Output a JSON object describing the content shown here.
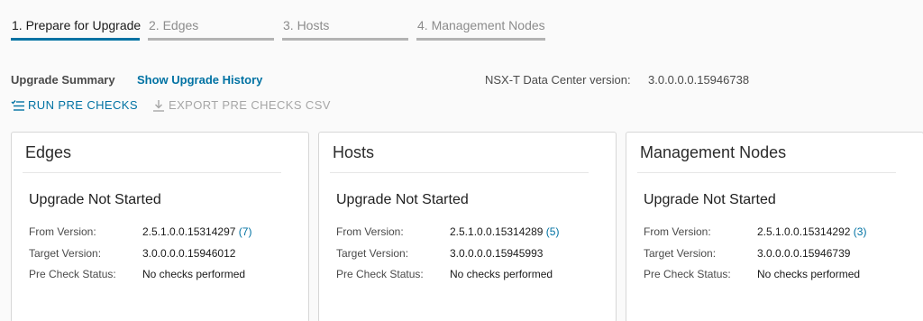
{
  "stepper": {
    "steps": [
      {
        "label": "1. Prepare for Upgrade"
      },
      {
        "label": "2. Edges"
      },
      {
        "label": "3. Hosts"
      },
      {
        "label": "4. Management Nodes"
      }
    ],
    "active_index": 0,
    "accent_color": "#0072a3"
  },
  "summary": {
    "title": "Upgrade Summary",
    "history_link": "Show Upgrade History",
    "version_label": "NSX-T Data Center version:",
    "version_value": "3.0.0.0.0.15946738"
  },
  "actions": {
    "run_pre_checks": "RUN PRE CHECKS",
    "run_icon": "list-check-icon",
    "export_csv": "EXPORT PRE CHECKS CSV",
    "export_icon": "download-icon"
  },
  "cards": [
    {
      "title": "Edges",
      "status": "Upgrade Not Started",
      "from_label": "From Version:",
      "from_value": "2.5.1.0.0.15314297",
      "from_count": "(7)",
      "target_label": "Target Version:",
      "target_value": "3.0.0.0.0.15946012",
      "precheck_label": "Pre Check Status:",
      "precheck_value": "No checks performed"
    },
    {
      "title": "Hosts",
      "status": "Upgrade Not Started",
      "from_label": "From Version:",
      "from_value": "2.5.1.0.0.15314289",
      "from_count": "(5)",
      "target_label": "Target Version:",
      "target_value": "3.0.0.0.0.15945993",
      "precheck_label": "Pre Check Status:",
      "precheck_value": "No checks performed"
    },
    {
      "title": "Management Nodes",
      "status": "Upgrade Not Started",
      "from_label": "From Version:",
      "from_value": "2.5.1.0.0.15314292",
      "from_count": "(3)",
      "target_label": "Target Version:",
      "target_value": "3.0.0.0.0.15946739",
      "precheck_label": "Pre Check Status:",
      "precheck_value": "No checks performed"
    }
  ]
}
